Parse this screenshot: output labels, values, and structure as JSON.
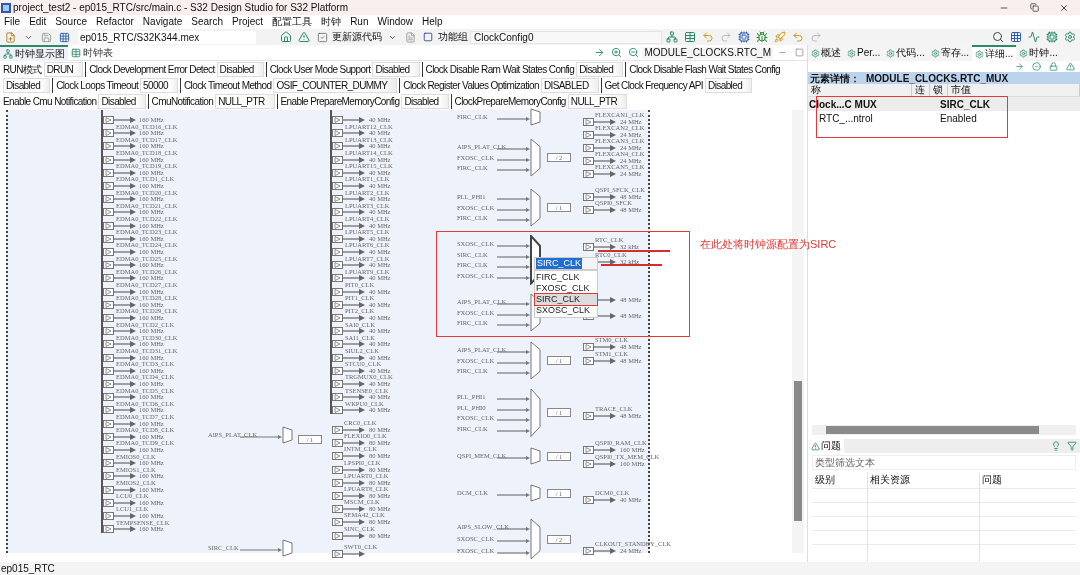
{
  "window": {
    "title": "project_test2 - ep015_RTC/src/main.c - S32 Design Studio for S32 Platform"
  },
  "menu": [
    "File",
    "Edit",
    "Source",
    "Refactor",
    "Navigate",
    "Search",
    "Project",
    "配置工具",
    "时钟",
    "Run",
    "Window",
    "Help"
  ],
  "toolbar": {
    "path": "ep015_RTC/S32K344.mex",
    "update_code": "更新源代码",
    "function_group_label": "功能组",
    "function_group": "ClockConfig0"
  },
  "editor_tabs": [
    {
      "label": "时钟显示图",
      "selected": true
    },
    {
      "label": "时钟表",
      "selected": false
    }
  ],
  "diagram_breadcrumb": "MODULE_CLOCKS.RTC_M",
  "config_rows": [
    [
      {
        "label": "RUN模式",
        "value": "DRUN"
      },
      {
        "label": "Clock Development Error Detect",
        "value": "Disabled"
      },
      {
        "label": "Clock User Mode Support",
        "value": "Disabled"
      },
      {
        "label": "Clock Disable Ram Wait States Config",
        "value": "Disabled"
      },
      {
        "label": "Clock Disable Flash Wait States Config"
      }
    ],
    [
      {
        "value": "Disabled"
      },
      {
        "label": "Clock Loops Timeout",
        "value": "50000"
      },
      {
        "label": "Clock Timeout Method",
        "value": "OSIF_COUNTER_DUMMY"
      },
      {
        "label": "Clock Register Values Optimization",
        "value": "DISABLED"
      },
      {
        "label": "Get Clock Frequency API",
        "value": "Disabled"
      }
    ],
    [
      {
        "label": "Enable Cmu Notification",
        "value": "Disabled"
      },
      {
        "label": "CmuNotification",
        "value": "NULL_PTR"
      },
      {
        "label": "Enable PrepareMemoryConfig",
        "value": "Disabled"
      },
      {
        "label": "ClockPrepareMemoryConfig",
        "value": "NULL_PTR"
      }
    ]
  ],
  "diagram": {
    "left_column": [
      {
        "freq": "160 MHz"
      },
      {
        "label": "EDMA0_TCD16_CLK",
        "freq": "160 MHz"
      },
      {
        "label": "EDMA0_TCD17_CLK",
        "freq": "160 MHz"
      },
      {
        "label": "EDMA0_TCD18_CLK",
        "freq": "160 MHz"
      },
      {
        "label": "EDMA0_TCD19_CLK",
        "freq": "160 MHz"
      },
      {
        "label": "EDMA0_TCD1_CLK",
        "freq": "160 MHz"
      },
      {
        "label": "EDMA0_TCD20_CLK",
        "freq": "160 MHz"
      },
      {
        "label": "EDMA0_TCD21_CLK",
        "freq": "160 MHz"
      },
      {
        "label": "EDMA0_TCD22_CLK",
        "freq": "160 MHz"
      },
      {
        "label": "EDMA0_TCD23_CLK",
        "freq": "160 MHz"
      },
      {
        "label": "EDMA0_TCD24_CLK",
        "freq": "160 MHz"
      },
      {
        "label": "EDMA0_TCD25_CLK",
        "freq": "160 MHz"
      },
      {
        "label": "EDMA0_TCD26_CLK",
        "freq": "160 MHz"
      },
      {
        "label": "EDMA0_TCD27_CLK",
        "freq": "160 MHz"
      },
      {
        "label": "EDMA0_TCD28_CLK",
        "freq": "160 MHz"
      },
      {
        "label": "EDMA0_TCD29_CLK",
        "freq": "160 MHz"
      },
      {
        "label": "EDMA0_TCD2_CLK",
        "freq": "160 MHz"
      },
      {
        "label": "EDMA0_TCD30_CLK",
        "freq": "160 MHz"
      },
      {
        "label": "EDMA0_TCD31_CLK",
        "freq": "160 MHz"
      },
      {
        "label": "EDMA0_TCD3_CLK",
        "freq": "160 MHz"
      },
      {
        "label": "EDMA0_TCD4_CLK",
        "freq": "160 MHz"
      },
      {
        "label": "EDMA0_TCD5_CLK",
        "freq": "160 MHz"
      },
      {
        "label": "EDMA0_TCD6_CLK",
        "freq": "160 MHz"
      },
      {
        "label": "EDMA0_TCD7_CLK",
        "freq": "160 MHz"
      },
      {
        "label": "EDMA0_TCD8_CLK",
        "freq": "160 MHz"
      },
      {
        "label": "EDMA0_TCD9_CLK",
        "freq": "160 MHz"
      },
      {
        "label": "EMIOS0_CLK",
        "freq": "160 MHz"
      },
      {
        "label": "EMIOS1_CLK",
        "freq": "160 MHz"
      },
      {
        "label": "EMIOS2_CLK",
        "freq": "160 MHz"
      },
      {
        "label": "LCU0_CLK",
        "freq": "160 MHz"
      },
      {
        "label": "LCU1_CLK",
        "freq": "160 MHz"
      },
      {
        "label": "TEMPSENSE_CLK",
        "freq": "160 MHz"
      }
    ],
    "middle_column": [
      {
        "freq": "40 MHz"
      },
      {
        "label": "LPUART12_CLK",
        "freq": "40 MHz"
      },
      {
        "label": "LPUART13_CLK",
        "freq": "40 MHz"
      },
      {
        "label": "LPUART14_CLK",
        "freq": "40 MHz"
      },
      {
        "label": "LPUART15_CLK",
        "freq": "40 MHz"
      },
      {
        "label": "LPUART1_CLK",
        "freq": "40 MHz"
      },
      {
        "label": "LPUART2_CLK",
        "freq": "40 MHz"
      },
      {
        "label": "LPUART3_CLK",
        "freq": "40 MHz"
      },
      {
        "label": "LPUART4_CLK",
        "freq": "40 MHz"
      },
      {
        "label": "LPUART5_CLK",
        "freq": "40 MHz"
      },
      {
        "label": "LPUART6_CLK",
        "freq": "40 MHz"
      },
      {
        "label": "LPUART7_CLK",
        "freq": "40 MHz"
      },
      {
        "label": "LPUART9_CLK",
        "freq": "40 MHz"
      },
      {
        "label": "PIT0_CLK",
        "freq": "40 MHz"
      },
      {
        "label": "PIT1_CLK",
        "freq": "40 MHz"
      },
      {
        "label": "PIT2_CLK",
        "freq": "40 MHz"
      },
      {
        "label": "SAI0_CLK",
        "freq": "40 MHz"
      },
      {
        "label": "SAI1_CLK",
        "freq": "40 MHz"
      },
      {
        "label": "SIUL2_CLK",
        "freq": "40 MHz"
      },
      {
        "label": "STCU0_CLK",
        "freq": "40 MHz"
      },
      {
        "label": "TRGMUX0_CLK",
        "freq": "40 MHz"
      },
      {
        "label": "TSENSE0_CLK",
        "freq": "40 MHz"
      },
      {
        "label": "WKPU0_CLK",
        "freq": "40 MHz"
      }
    ],
    "middle_groups": [
      {
        "inputs": [
          "AIPS_PLAT_CLK"
        ],
        "divider": "/ 1",
        "outputs": [
          {
            "label": "CRC0_CLK",
            "freq": "80 MHz"
          },
          {
            "label": "FLEXIO0_CLK",
            "freq": "80 MHz"
          },
          {
            "label": "INTM_CLK",
            "freq": "80 MHz"
          },
          {
            "label": "LPSPI0_CLK",
            "freq": "80 MHz"
          },
          {
            "label": "LPUART0_CLK",
            "freq": "80 MHz"
          },
          {
            "label": "LPUART8_CLK",
            "freq": "80 MHz"
          },
          {
            "label": "MSCM_CLK",
            "freq": "80 MHz"
          },
          {
            "label": "SEMA42_CLK",
            "freq": "80 MHz"
          },
          {
            "label": "SINC_CLK",
            "freq": "80 MHz"
          }
        ]
      },
      {
        "inputs": [
          "SIRC_CLK"
        ],
        "outputs": [
          {
            "label": "SWT0_CLK"
          }
        ]
      }
    ],
    "right_groups": [
      {
        "inputs": [
          "FIRC_CLK"
        ]
      },
      {
        "inputs": [
          "AIPS_PLAT_CLK",
          "FXOSC_CLK",
          "FIRC_CLK"
        ],
        "divider": "/ 2",
        "outputs": [
          {
            "label": "FLEXCAN1_CLK",
            "freq": "24 MHz"
          },
          {
            "label": "FLEXCAN2_CLK",
            "freq": "24 MHz"
          },
          {
            "label": "FLEXCAN3_CLK",
            "freq": "24 MHz"
          },
          {
            "label": "FLEXCAN4_CLK",
            "freq": "24 MHz"
          },
          {
            "label": "FLEXCAN5_CLK",
            "freq": "24 MHz"
          }
        ]
      },
      {
        "inputs": [
          "PLL_PHI1",
          "FXOSC_CLK",
          "FIRC_CLK"
        ],
        "divider": "/ 1",
        "outputs": [
          {
            "label": "QSPI_SFCK_CLK",
            "freq": "48 MHz"
          },
          {
            "label": "QSPI0_SFCK",
            "freq": "48 MHz"
          }
        ]
      },
      {
        "inputs": [
          "SXOSC_CLK",
          "SIRC_CLK",
          "FIRC_CLK",
          "FXOSC_CLK"
        ],
        "outputs": [
          {
            "label": "RTC_CLK",
            "freq": "32 kHz"
          },
          {
            "label": "RTC0_CLK",
            "freq": "32 kHz"
          }
        ]
      },
      {
        "inputs": [
          "AIPS_PLAT_CLK",
          "FXOSC_CLK",
          "FIRC_CLK"
        ],
        "outputs": [
          {
            "freq": "48 MHz"
          },
          {
            "freq": "48 MHz"
          }
        ]
      },
      {
        "inputs": [
          "AIPS_PLAT_CLK",
          "FXOSC_CLK",
          "FIRC_CLK"
        ],
        "divider": "/ 1",
        "outputs": [
          {
            "label": "STM0_CLK",
            "freq": "48 MHz"
          },
          {
            "label": "STM1_CLK",
            "freq": "48 MHz"
          }
        ]
      },
      {
        "inputs": [
          "PLL_PHI1",
          "PLL_PHI0",
          "FXOSC_CLK",
          "FIRC_CLK"
        ],
        "divider": "/ 1",
        "outputs": [
          {
            "label": "TRACE_CLK",
            "freq": "48 MHz"
          }
        ]
      },
      {
        "inputs": [
          "QSPI_MEM_CLK"
        ],
        "divider": "/ 1",
        "outputs": [
          {
            "label": "QSPI0_RAM_CLK",
            "freq": "160 MHz"
          },
          {
            "label": "QSPI0_TX_MEM_CLK",
            "freq": "160 MHz"
          }
        ]
      },
      {
        "inputs": [
          "DCM_CLK"
        ],
        "divider": "/ 1",
        "outputs": [
          {
            "label": "DCM0_CLK",
            "freq": "40 MHz"
          }
        ]
      },
      {
        "inputs": [
          "AIPS_SLOW_CLK",
          "SXOSC_CLK",
          "FXOSC_CLK"
        ],
        "divider": "/ 2",
        "outputs": [
          {
            "label": "CLKOUT_STANDBY_CLK",
            "freq": "24 MHz"
          }
        ]
      }
    ],
    "dropdown": {
      "value": "SIRC_CLK",
      "options": [
        {
          "label": "FIRC_CLK",
          "selected": false
        },
        {
          "label": "FXOSC_CLK",
          "selected": false
        },
        {
          "label": "SIRC_CLK",
          "selected": true
        },
        {
          "label": "SXOSC_CLK",
          "selected": false
        }
      ]
    },
    "annotation": "在此处将时钟源配置为SIRC"
  },
  "right_panel": {
    "tabs": [
      {
        "label": "概述",
        "selected": false
      },
      {
        "label": "Per...",
        "selected": false
      },
      {
        "label": "代码...",
        "selected": false
      },
      {
        "label": "寄存...",
        "selected": false
      },
      {
        "label": "详细...",
        "selected": true
      },
      {
        "label": "时钟...",
        "selected": false
      }
    ],
    "title_label": "元素详情：",
    "title": "MODULE_CLOCKS.RTC_MUX",
    "columns": [
      "称",
      "连",
      "锁",
      "市值"
    ],
    "rows": [
      {
        "kind": "category",
        "name": "Clock...C MUX",
        "value": "SIRC_CLK"
      },
      {
        "kind": "property",
        "name": "RTC_...ntrol",
        "value": "Enabled"
      }
    ]
  },
  "problems": {
    "tab": "问题",
    "filter_placeholder": "类型筛选文本",
    "columns": [
      "级别",
      "相关资源",
      "问题"
    ]
  },
  "status_bar": "ep015_RTC"
}
